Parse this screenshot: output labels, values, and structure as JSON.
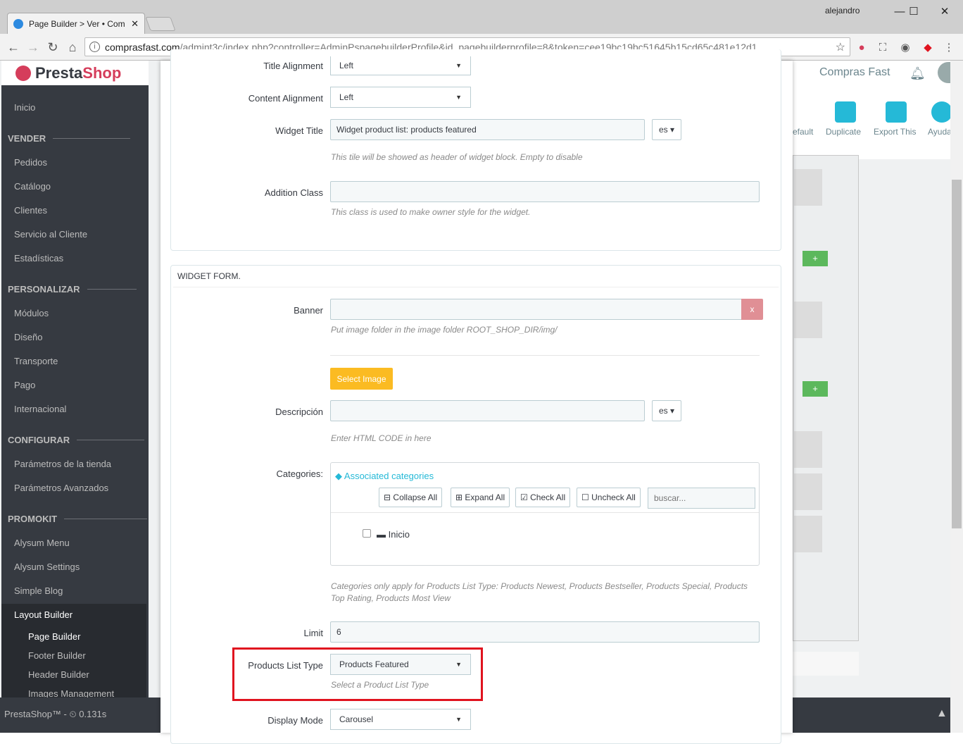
{
  "browser": {
    "tab_title": "Page Builder > Ver • Com",
    "tab_close": "✕",
    "user": "alejandro",
    "url_host": "comprasfast.com",
    "url_path": "/admint3c/index.php?controller=AdminPspagebuilderProfile&id_pagebuilderprofile=8&token=cee19bc19bc51645b15cd65c481e12d1"
  },
  "header": {
    "logo_a": "Presta",
    "logo_b": "Shop",
    "shop_name": "Compras Fast",
    "btn_default": "efault",
    "btn_duplicate": "Duplicate",
    "btn_export": "Export This",
    "btn_help": "Ayuda"
  },
  "sidebar": {
    "inicio": "Inicio",
    "vender": "VENDER",
    "pedidos": "Pedidos",
    "catalogo": "Catálogo",
    "clientes": "Clientes",
    "servicio": "Servicio al Cliente",
    "estadisticas": "Estadísticas",
    "personalizar": "PERSONALIZAR",
    "modulos": "Módulos",
    "diseno": "Diseño",
    "transporte": "Transporte",
    "pago": "Pago",
    "internacional": "Internacional",
    "configurar": "CONFIGURAR",
    "param_tienda": "Parámetros de la tienda",
    "param_avanzados": "Parámetros Avanzados",
    "promokit": "PROMOKIT",
    "alysum_menu": "Alysum Menu",
    "alysum_settings": "Alysum Settings",
    "simple_blog": "Simple Blog",
    "layout_builder": "Layout Builder",
    "page_builder": "Page Builder",
    "footer_builder": "Footer Builder",
    "header_builder": "Header Builder",
    "images_management": "Images Management"
  },
  "footer": {
    "text": "PrestaShop™ - ⏲ 0.131s"
  },
  "form": {
    "title_alignment_label": "Title Alignment",
    "title_alignment_value": "Left",
    "content_alignment_label": "Content Alignment",
    "content_alignment_value": "Left",
    "widget_title_label": "Widget Title",
    "widget_title_value": "Widget product list: products featured",
    "lang": "es",
    "widget_title_help": "This tile will be showed as header of widget block. Empty to disable",
    "addition_class_label": "Addition Class",
    "addition_class_help": "This class is used to make owner style for the widget.",
    "panel2_heading": "WIDGET FORM.",
    "banner_label": "Banner",
    "banner_clear": "x",
    "banner_help": "Put image folder in the image folder ROOT_SHOP_DIR/img/",
    "select_image": "Select Image",
    "descripcion_label": "Descripción",
    "descripcion_help": "Enter HTML CODE in here",
    "categories_label": "Categories:",
    "associated_categories": "Associated categories",
    "collapse_all": "Collapse All",
    "expand_all": "Expand All",
    "check_all": "Check All",
    "uncheck_all": "Uncheck All",
    "search_placeholder": "buscar...",
    "tree_root": "Inicio",
    "categories_help": "Categories only apply for Products List Type: Products Newest, Products Bestseller, Products Special, Products Top Rating, Products Most View",
    "limit_label": "Limit",
    "limit_value": "6",
    "plt_label": "Products List Type",
    "plt_value": "Products Featured",
    "plt_help": "Select a Product List Type",
    "display_mode_label": "Display Mode",
    "display_mode_value": "Carousel"
  },
  "colors": {
    "highlight": "#e0131f",
    "warning": "#fbbb22",
    "danger": "#e08f95",
    "link": "#25b9d7"
  }
}
